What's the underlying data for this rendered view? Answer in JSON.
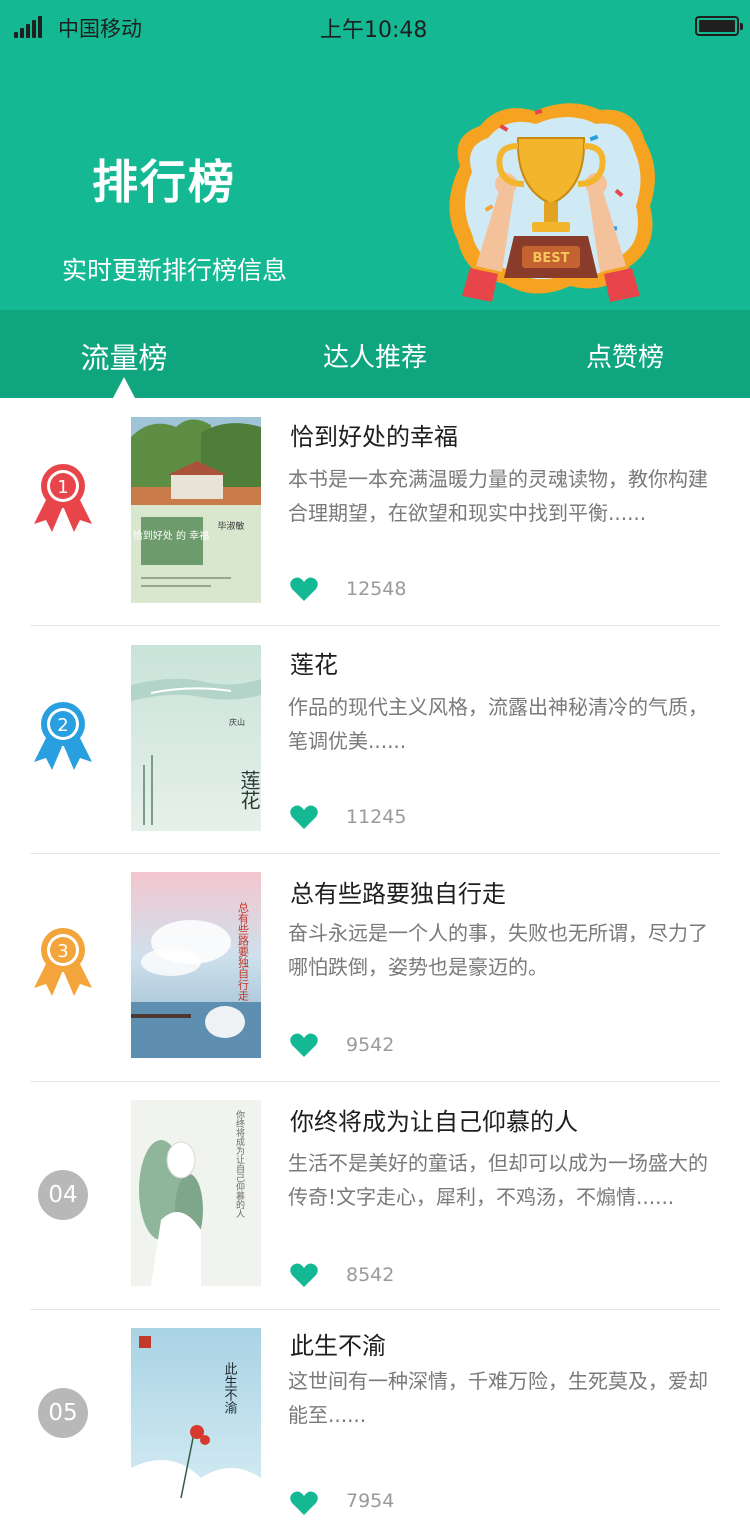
{
  "status_bar": {
    "carrier": "中国移动",
    "time": "上午10:48"
  },
  "header": {
    "title": "排行榜",
    "subtitle": "实时更新排行榜信息",
    "illustration_text": "BEST",
    "background": "#14b993"
  },
  "tabs": [
    {
      "label": "流量榜",
      "active": true
    },
    {
      "label": "达人推荐",
      "active": false
    },
    {
      "label": "点赞榜",
      "active": false
    }
  ],
  "colors": {
    "accent": "#14b993",
    "tab_bar": "#0fa67f",
    "like": "#14b993",
    "rank1": "#e8454b",
    "rank2": "#2a9fe0",
    "rank3": "#f3a43a",
    "rank_other": "#b8b8b8"
  },
  "books": [
    {
      "rank": "1",
      "title": "恰到好处的幸福",
      "description": "本书是一本充满温暖力量的灵魂读物，教你构建合理期望，在欲望和现实中找到平衡......",
      "likes": "12548",
      "cover_title": "恰到好处 的 幸福",
      "cover_author": "毕淑敏"
    },
    {
      "rank": "2",
      "title": "莲花",
      "description": "作品的现代主义风格，流露出神秘清冷的气质，笔调优美......",
      "likes": "11245",
      "cover_title": "莲花",
      "cover_author": "庆山"
    },
    {
      "rank": "3",
      "title": "总有些路要独自行走",
      "description": "奋斗永远是一个人的事，失败也无所谓，尽力了哪怕跌倒，姿势也是豪迈的。",
      "likes": "9542",
      "cover_title": "总有些路要独自行走"
    },
    {
      "rank": "04",
      "title": "你终将成为让自己仰慕的人",
      "description": "生活不是美好的童话，但却可以成为一场盛大的传奇!文字走心，犀利，不鸡汤，不煽情......",
      "likes": "8542",
      "cover_title": "你终将成为让自己仰慕的人"
    },
    {
      "rank": "05",
      "title": "此生不渝",
      "description": "这世间有一种深情，千难万险，生死莫及，爱却能至......",
      "likes": "7954",
      "cover_title": "此生不渝"
    }
  ]
}
